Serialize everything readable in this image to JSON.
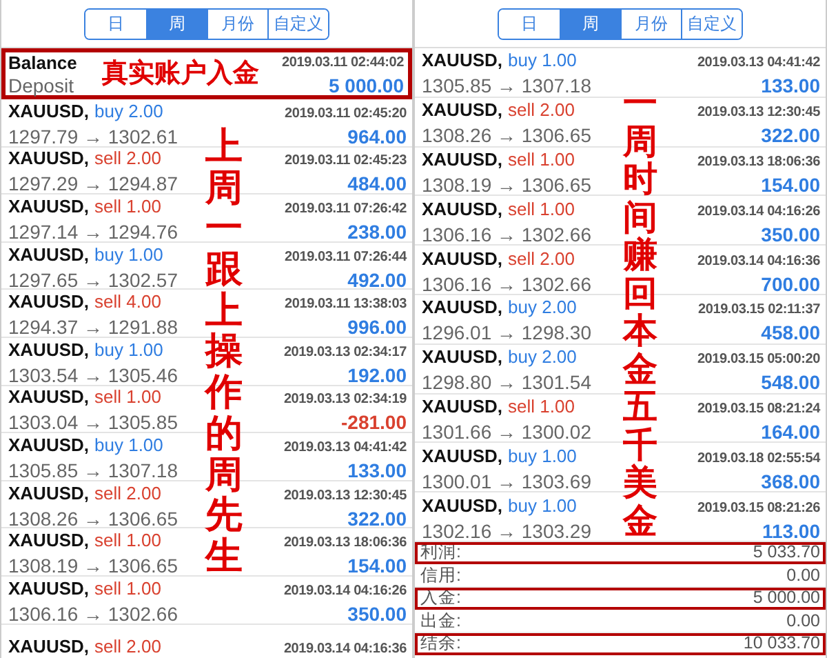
{
  "panels": [
    {
      "tabs": [
        {
          "label": "日",
          "selected": false
        },
        {
          "label": "周",
          "selected": true
        },
        {
          "label": "月份",
          "selected": false
        },
        {
          "label": "自定义",
          "selected": false
        }
      ],
      "deposit": {
        "title": "Balance",
        "type": "Deposit",
        "time": "2019.03.11 02:44:02",
        "amount": "5 000.00",
        "highlighted": true,
        "note": "真实账户入金"
      },
      "trades": [
        {
          "symbol": "XAUUSD,",
          "kind": "buy",
          "action": "buy 2.00",
          "prices": "1297.79 → 1302.61",
          "time": "2019.03.11 02:45:20",
          "profit": "964.00",
          "loss": false
        },
        {
          "symbol": "XAUUSD,",
          "kind": "sell",
          "action": "sell 2.00",
          "prices": "1297.29 → 1294.87",
          "time": "2019.03.11 02:45:23",
          "profit": "484.00",
          "loss": false
        },
        {
          "symbol": "XAUUSD,",
          "kind": "sell",
          "action": "sell 1.00",
          "prices": "1297.14 → 1294.76",
          "time": "2019.03.11 07:26:42",
          "profit": "238.00",
          "loss": false
        },
        {
          "symbol": "XAUUSD,",
          "kind": "buy",
          "action": "buy 1.00",
          "prices": "1297.65 → 1302.57",
          "time": "2019.03.11 07:26:44",
          "profit": "492.00",
          "loss": false
        },
        {
          "symbol": "XAUUSD,",
          "kind": "sell",
          "action": "sell 4.00",
          "prices": "1294.37 → 1291.88",
          "time": "2019.03.11 13:38:03",
          "profit": "996.00",
          "loss": false
        },
        {
          "symbol": "XAUUSD,",
          "kind": "buy",
          "action": "buy 1.00",
          "prices": "1303.54 → 1305.46",
          "time": "2019.03.13 02:34:17",
          "profit": "192.00",
          "loss": false
        },
        {
          "symbol": "XAUUSD,",
          "kind": "sell",
          "action": "sell 1.00",
          "prices": "1303.04 → 1305.85",
          "time": "2019.03.13 02:34:19",
          "profit": "-281.00",
          "loss": true
        },
        {
          "symbol": "XAUUSD,",
          "kind": "buy",
          "action": "buy 1.00",
          "prices": "1305.85 → 1307.18",
          "time": "2019.03.13 04:41:42",
          "profit": "133.00",
          "loss": false
        },
        {
          "symbol": "XAUUSD,",
          "kind": "sell",
          "action": "sell 2.00",
          "prices": "1308.26 → 1306.65",
          "time": "2019.03.13 12:30:45",
          "profit": "322.00",
          "loss": false
        },
        {
          "symbol": "XAUUSD,",
          "kind": "sell",
          "action": "sell 1.00",
          "prices": "1308.19 → 1306.65",
          "time": "2019.03.13 18:06:36",
          "profit": "154.00",
          "loss": false
        },
        {
          "symbol": "XAUUSD,",
          "kind": "sell",
          "action": "sell 1.00",
          "prices": "1306.16 → 1302.66",
          "time": "2019.03.14 04:16:26",
          "profit": "350.00",
          "loss": false
        },
        {
          "symbol": "XAUUSD,",
          "kind": "sell",
          "action": "sell 2.00",
          "time": "2019.03.14 04:16:36"
        }
      ],
      "annotation": "上周一跟上操作的周先生"
    },
    {
      "tabs": [
        {
          "label": "日",
          "selected": false
        },
        {
          "label": "周",
          "selected": true
        },
        {
          "label": "月份",
          "selected": false
        },
        {
          "label": "自定义",
          "selected": false
        }
      ],
      "trades": [
        {
          "symbol": "XAUUSD,",
          "kind": "buy",
          "action": "buy 1.00",
          "prices": "1305.85 → 1307.18",
          "time": "2019.03.13 04:41:42",
          "profit": "133.00",
          "loss": false
        },
        {
          "symbol": "XAUUSD,",
          "kind": "sell",
          "action": "sell 2.00",
          "prices": "1308.26 → 1306.65",
          "time": "2019.03.13 12:30:45",
          "profit": "322.00",
          "loss": false
        },
        {
          "symbol": "XAUUSD,",
          "kind": "sell",
          "action": "sell 1.00",
          "prices": "1308.19 → 1306.65",
          "time": "2019.03.13 18:06:36",
          "profit": "154.00",
          "loss": false
        },
        {
          "symbol": "XAUUSD,",
          "kind": "sell",
          "action": "sell 1.00",
          "prices": "1306.16 → 1302.66",
          "time": "2019.03.14 04:16:26",
          "profit": "350.00",
          "loss": false
        },
        {
          "symbol": "XAUUSD,",
          "kind": "sell",
          "action": "sell 2.00",
          "prices": "1306.16 → 1302.66",
          "time": "2019.03.14 04:16:36",
          "profit": "700.00",
          "loss": false
        },
        {
          "symbol": "XAUUSD,",
          "kind": "buy",
          "action": "buy 2.00",
          "prices": "1296.01 → 1298.30",
          "time": "2019.03.15 02:11:37",
          "profit": "458.00",
          "loss": false
        },
        {
          "symbol": "XAUUSD,",
          "kind": "buy",
          "action": "buy 2.00",
          "prices": "1298.80 → 1301.54",
          "time": "2019.03.15 05:00:20",
          "profit": "548.00",
          "loss": false
        },
        {
          "symbol": "XAUUSD,",
          "kind": "sell",
          "action": "sell 1.00",
          "prices": "1301.66 → 1300.02",
          "time": "2019.03.15 08:21:24",
          "profit": "164.00",
          "loss": false
        },
        {
          "symbol": "XAUUSD,",
          "kind": "buy",
          "action": "buy 1.00",
          "prices": "1300.01 → 1303.69",
          "time": "2019.03.18 02:55:54",
          "profit": "368.00",
          "loss": false
        },
        {
          "symbol": "XAUUSD,",
          "kind": "buy",
          "action": "buy 1.00",
          "prices": "1302.16 → 1303.29",
          "time": "2019.03.15 08:21:26",
          "profit": "113.00",
          "loss": false
        }
      ],
      "summary": [
        {
          "label": "利润:",
          "value": "5 033.70",
          "highlighted": true
        },
        {
          "label": "信用:",
          "value": "0.00",
          "highlighted": false
        },
        {
          "label": "入金:",
          "value": "5 000.00",
          "highlighted": true
        },
        {
          "label": "出金:",
          "value": "0.00",
          "highlighted": false
        },
        {
          "label": "结余:",
          "value": "10 033.70",
          "highlighted": true
        }
      ],
      "annotation": "一周时间赚回本金五千美金"
    }
  ]
}
